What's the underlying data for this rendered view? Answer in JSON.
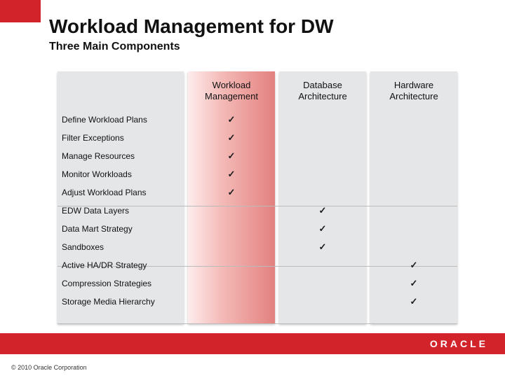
{
  "title": "Workload Management for DW",
  "subtitle": "Three Main Components",
  "columns": {
    "c0": "",
    "c1": "Workload Management",
    "c2": "Database Architecture",
    "c3": "Hardware Architecture"
  },
  "rows": {
    "g1": {
      "r1": {
        "label": "Define Workload Plans",
        "c1": "✓",
        "c2": "",
        "c3": ""
      },
      "r2": {
        "label": "Filter Exceptions",
        "c1": "✓",
        "c2": "",
        "c3": ""
      },
      "r3": {
        "label": "Manage Resources",
        "c1": "✓",
        "c2": "",
        "c3": ""
      },
      "r4": {
        "label": "Monitor Workloads",
        "c1": "✓",
        "c2": "",
        "c3": ""
      },
      "r5": {
        "label": "Adjust Workload Plans",
        "c1": "✓",
        "c2": "",
        "c3": ""
      }
    },
    "g2": {
      "r1": {
        "label": "EDW Data Layers",
        "c1": "",
        "c2": "✓",
        "c3": ""
      },
      "r2": {
        "label": "Data Mart Strategy",
        "c1": "",
        "c2": "✓",
        "c3": ""
      },
      "r3": {
        "label": "Sandboxes",
        "c1": "",
        "c2": "✓",
        "c3": ""
      }
    },
    "g3": {
      "r1": {
        "label": "Active HA/DR Strategy",
        "c1": "",
        "c2": "",
        "c3": "✓"
      },
      "r2": {
        "label": "Compression Strategies",
        "c1": "",
        "c2": "",
        "c3": "✓"
      },
      "r3": {
        "label": "Storage Media Hierarchy",
        "c1": "",
        "c2": "",
        "c3": "✓"
      }
    }
  },
  "logo": "ORACLE",
  "footer": "© 2010 Oracle Corporation"
}
